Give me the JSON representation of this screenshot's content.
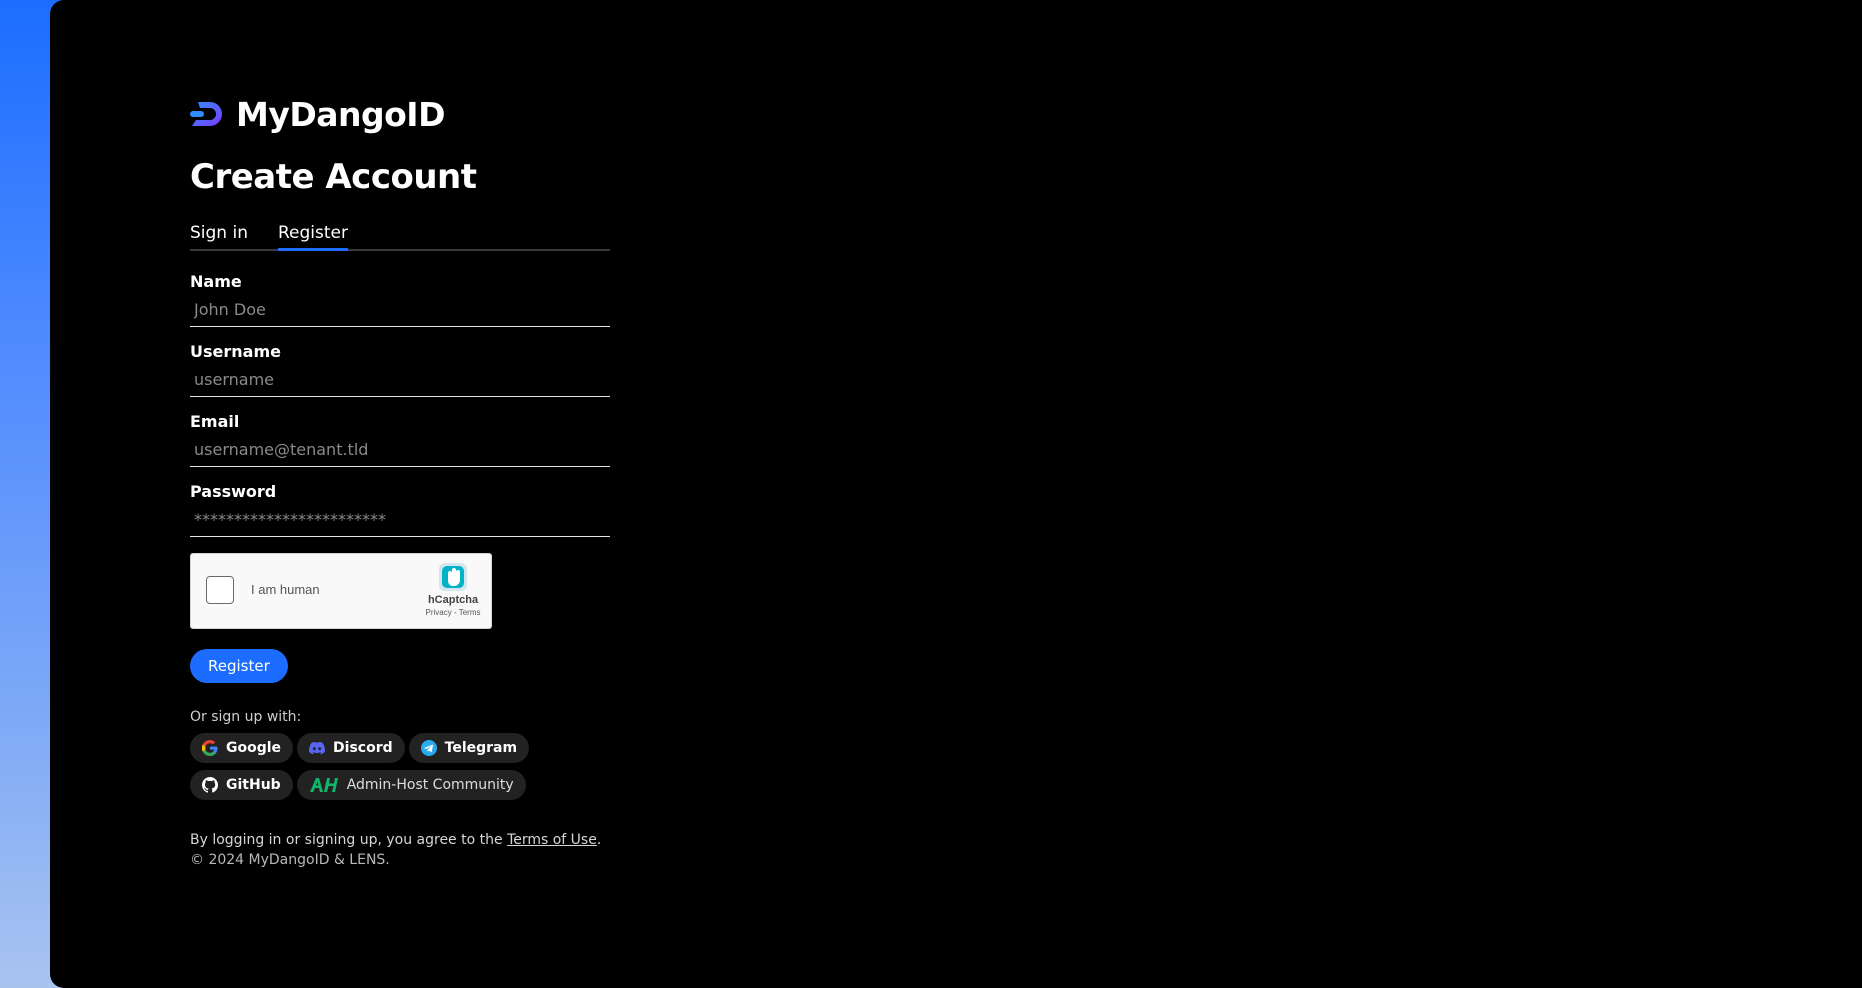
{
  "brand": {
    "name": "MyDangoID"
  },
  "page": {
    "title": "Create Account"
  },
  "tabs": [
    {
      "label": "Sign in",
      "active": false
    },
    {
      "label": "Register",
      "active": true
    }
  ],
  "form": {
    "name": {
      "label": "Name",
      "placeholder": "John Doe",
      "value": ""
    },
    "username": {
      "label": "Username",
      "placeholder": "username",
      "value": ""
    },
    "email": {
      "label": "Email",
      "placeholder": "username@tenant.tld",
      "value": ""
    },
    "password": {
      "label": "Password",
      "placeholder": "************************",
      "value": ""
    }
  },
  "captcha": {
    "label": "I am human",
    "brand": "hCaptcha",
    "links": "Privacy - Terms"
  },
  "register_button": "Register",
  "alt_signup": {
    "label": "Or sign up with:",
    "providers": [
      {
        "name": "Google",
        "icon": "google-icon"
      },
      {
        "name": "Discord",
        "icon": "discord-icon"
      },
      {
        "name": "Telegram",
        "icon": "telegram-icon"
      },
      {
        "name": "GitHub",
        "icon": "github-icon"
      },
      {
        "name": "Admin-Host Community",
        "icon": "admin-host-icon"
      }
    ]
  },
  "legal": {
    "prefix": "By logging in or signing up, you agree to the ",
    "terms_link": "Terms of Use",
    "suffix": ".",
    "copyright": "© 2024 MyDangoID & LENS."
  },
  "colors": {
    "accent": "#1c6dff",
    "panel": "#000000",
    "chip": "#222222"
  }
}
